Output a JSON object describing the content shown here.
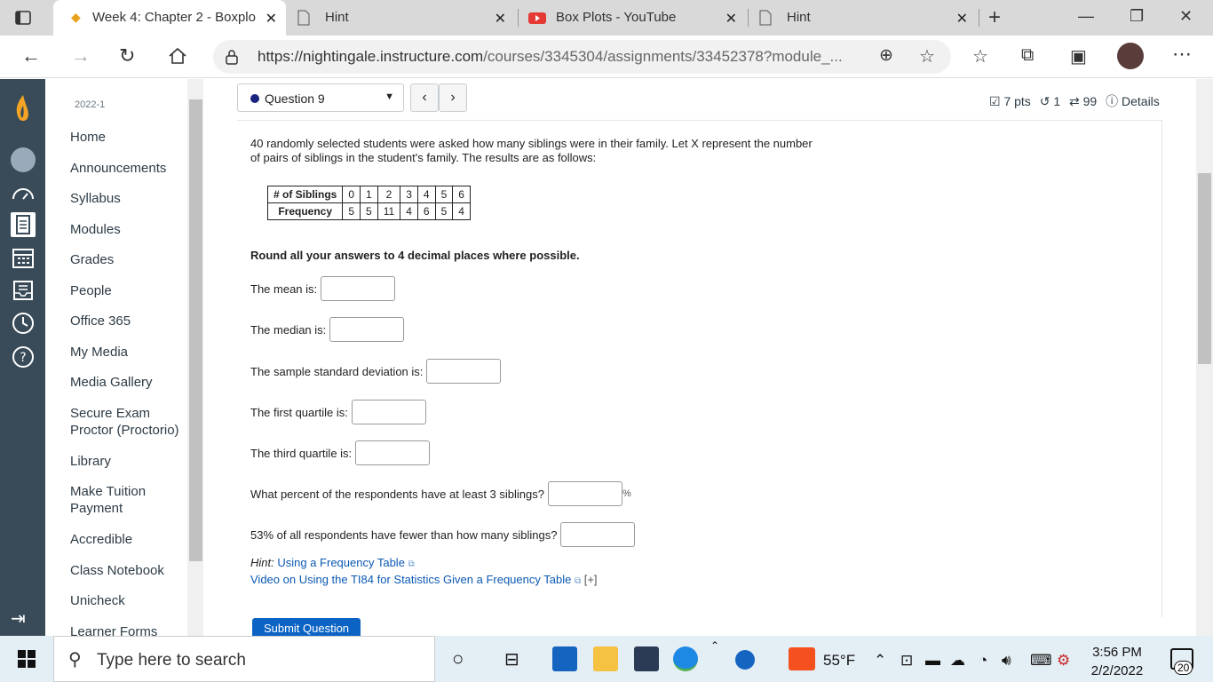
{
  "browser": {
    "tabs": [
      {
        "title": "Week 4: Chapter 2 - Boxplo",
        "active": true
      },
      {
        "title": "Hint",
        "active": false
      },
      {
        "title": "Box Plots - YouTube",
        "active": false
      },
      {
        "title": "Hint",
        "active": false
      }
    ],
    "url_main": "https://nightingale.instructure.com",
    "url_path": "/courses/3345304/assignments/33452378?module_..."
  },
  "course_nav": {
    "term": "2022-1",
    "items": [
      "Home",
      "Announcements",
      "Syllabus",
      "Modules",
      "Grades",
      "People",
      "Office 365",
      "My Media",
      "Media Gallery",
      "Secure Exam Proctor (Proctorio)",
      "Library",
      "Make Tuition Payment",
      "Accredible",
      "Class Notebook",
      "Unicheck",
      "Learner Forms"
    ]
  },
  "question": {
    "selector_label": "Question 9",
    "points": "7 pts",
    "undo_count": "1",
    "attempts": "99",
    "details_label": "Details",
    "prompt": "40 randomly selected students were asked how many siblings were in their family. Let X represent the number of pairs of siblings in the student's family. The results are as follows:",
    "table": {
      "row1_label": "# of Siblings",
      "row2_label": "Frequency",
      "siblings": [
        "0",
        "1",
        "2",
        "3",
        "4",
        "5",
        "6"
      ],
      "frequency": [
        "5",
        "5",
        "11",
        "4",
        "6",
        "5",
        "4"
      ]
    },
    "round_note": "Round all your answers to 4 decimal places where possible.",
    "fields": [
      {
        "label": "The mean is:",
        "suffix": ""
      },
      {
        "label": "The median is:",
        "suffix": ""
      },
      {
        "label": "The sample standard deviation is:",
        "suffix": ""
      },
      {
        "label": "The first quartile is:",
        "suffix": ""
      },
      {
        "label": "The third quartile is:",
        "suffix": ""
      },
      {
        "label": "What percent of the respondents have at least 3 siblings?",
        "suffix": "%"
      },
      {
        "label": "53% of all respondents have fewer than how many siblings?",
        "suffix": ""
      }
    ],
    "hint_prefix": "Hint:",
    "hint_link": "Using a Frequency Table",
    "video_link": "Video on Using the TI84 for Statistics Given a Frequency Table",
    "expand": "[+]",
    "submit_label": "Submit Question"
  },
  "taskbar": {
    "search_placeholder": "Type here to search",
    "weather": "55°F",
    "time": "3:56 PM",
    "date": "2/2/2022",
    "notification_count": "20"
  },
  "colors": {
    "global_nav": "#394b58",
    "link": "#0b59b3",
    "submit": "#0b63c4"
  }
}
